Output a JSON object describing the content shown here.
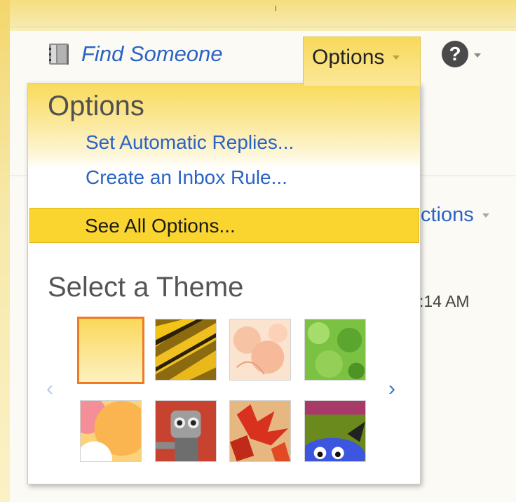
{
  "header": {
    "find_someone": "Find Someone",
    "options_tab": "Options",
    "help_glyph": "?"
  },
  "menu": {
    "heading": "Options",
    "items": [
      {
        "label": "Set Automatic Replies..."
      },
      {
        "label": "Create an Inbox Rule..."
      },
      {
        "label": "See All Options...",
        "highlighted": true
      }
    ],
    "theme_heading": "Select a Theme",
    "themes": [
      {
        "name": "default-yellow",
        "selected": true
      },
      {
        "name": "tiger"
      },
      {
        "name": "peach-petals"
      },
      {
        "name": "green-leaves"
      },
      {
        "name": "sunset-circles"
      },
      {
        "name": "robot"
      },
      {
        "name": "autumn-leaves"
      },
      {
        "name": "blue-monster"
      }
    ],
    "nav": {
      "prev_glyph": "‹",
      "next_glyph": "›"
    }
  },
  "background": {
    "actions_partial": "ctions",
    "time_partial": ":14 AM"
  },
  "colors": {
    "accent_yellow": "#fad52f",
    "link_blue": "#2a63c6",
    "selected_border": "#ef7a23"
  }
}
